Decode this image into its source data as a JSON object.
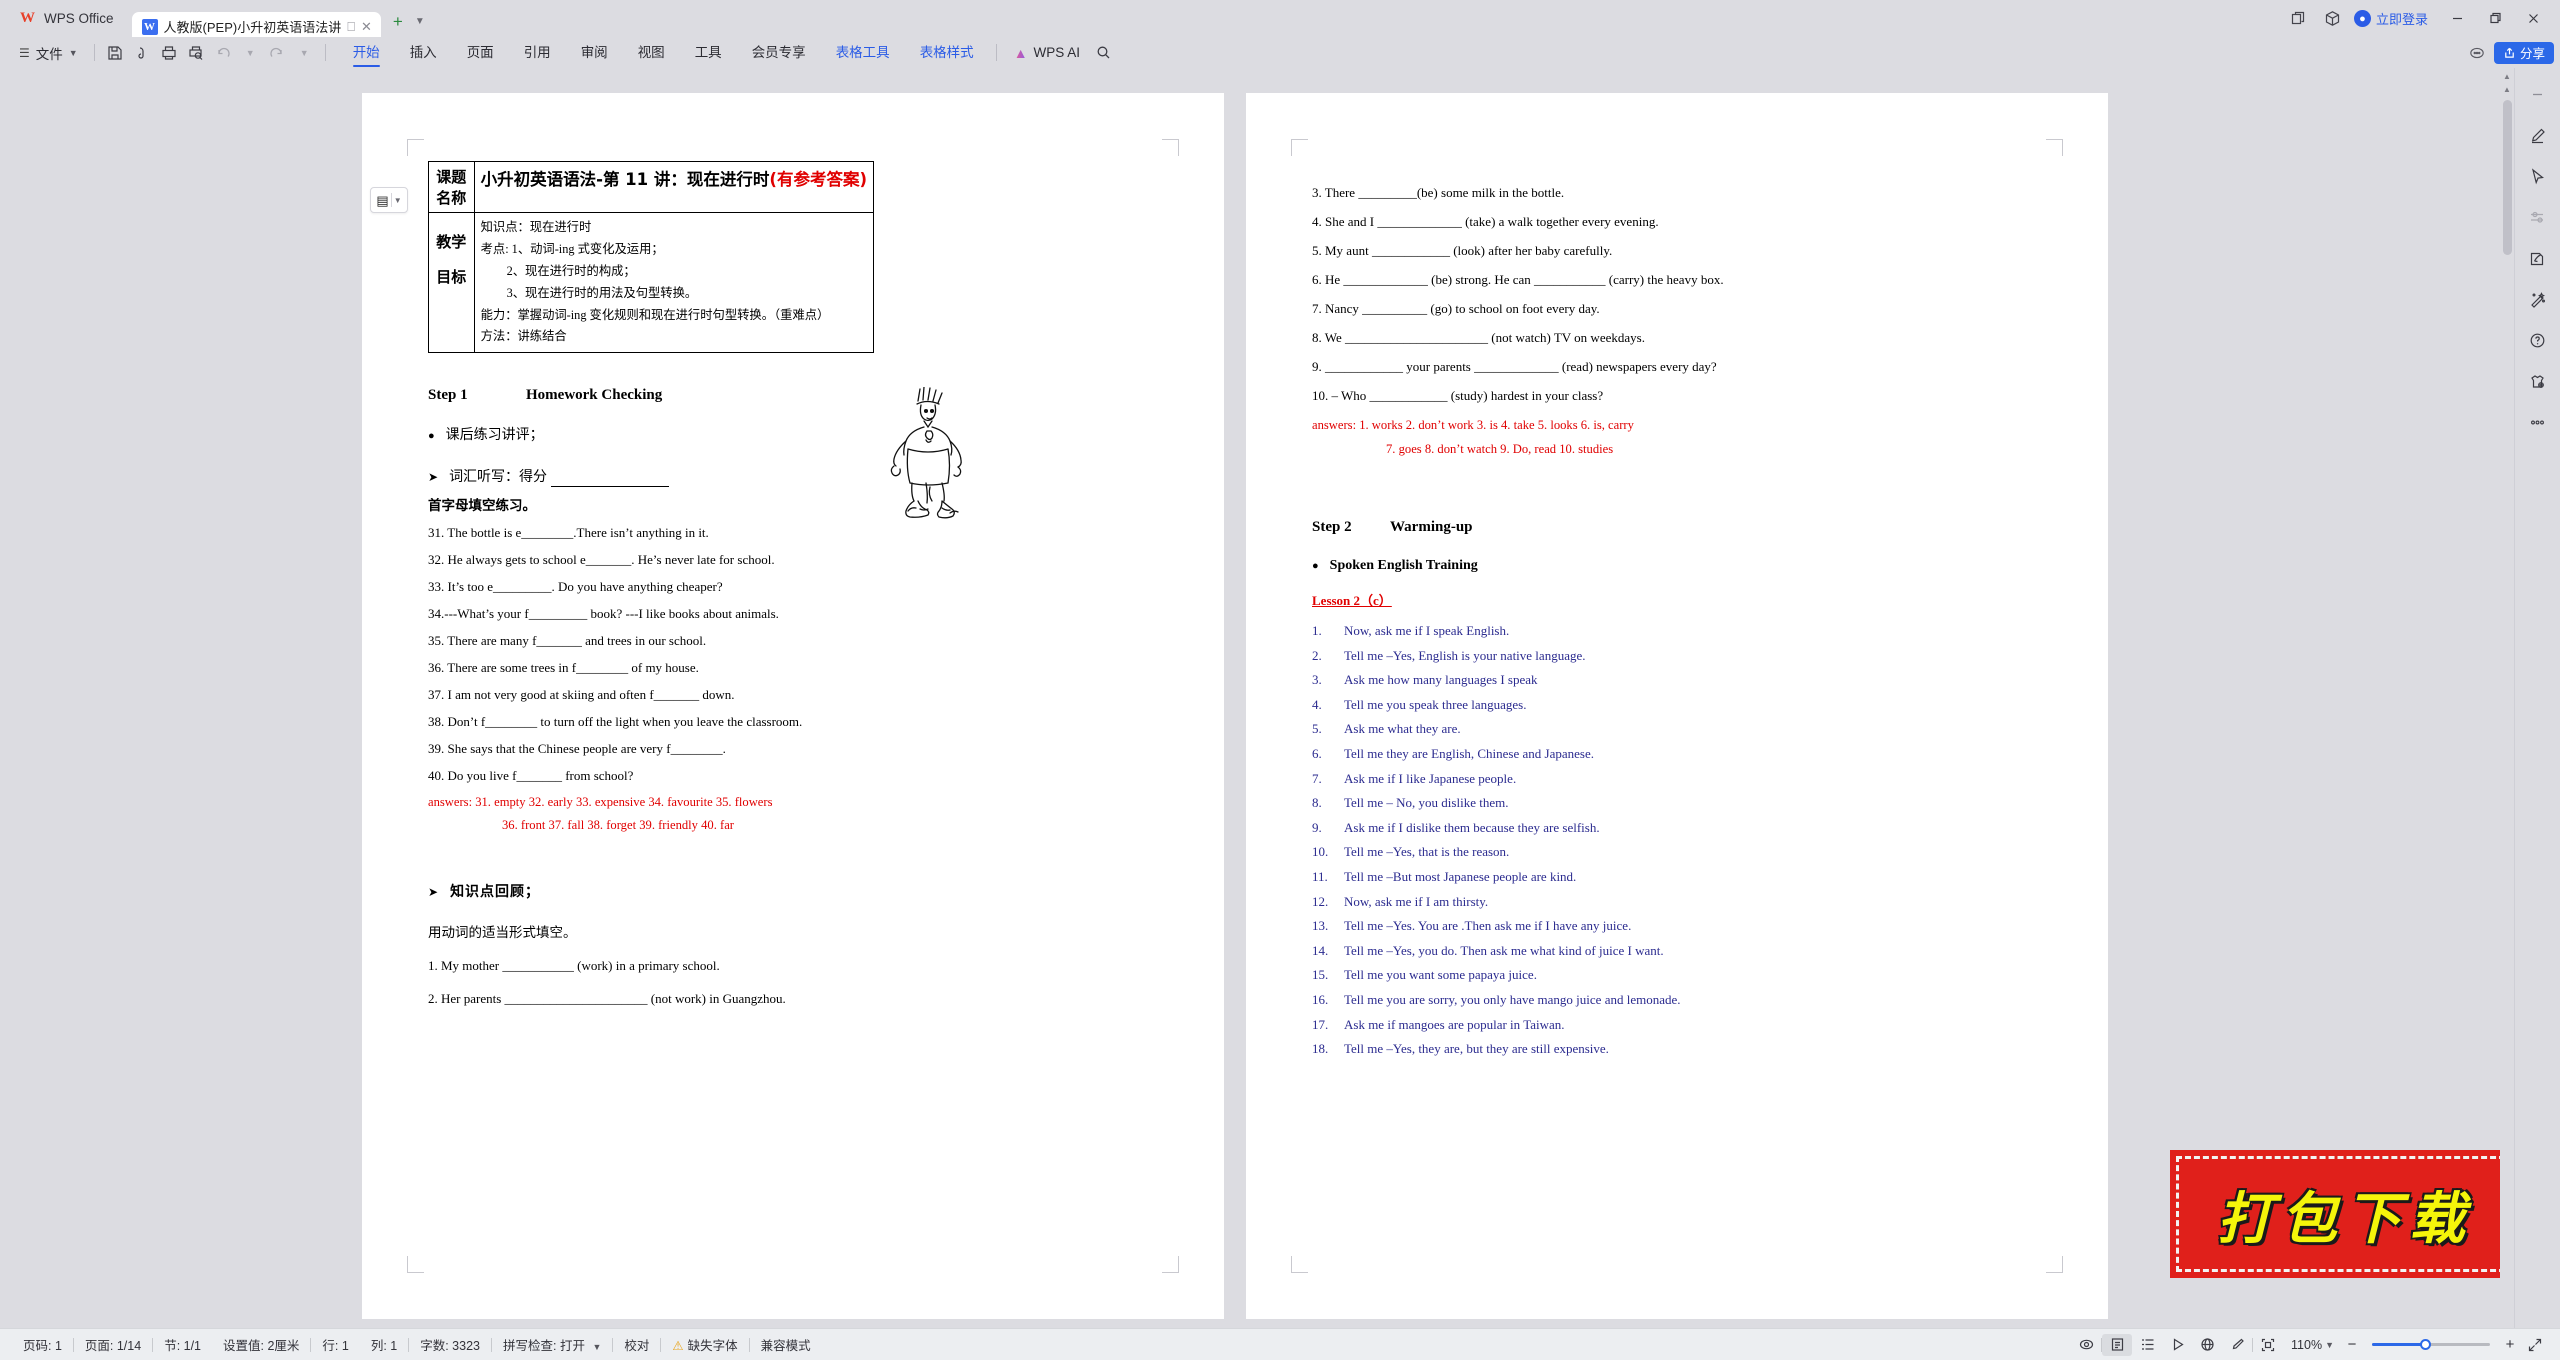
{
  "app": {
    "name": "WPS Office",
    "tab_title": "人教版(PEP)小升初英语语法讲",
    "login_label": "立即登录",
    "share_label": "分享"
  },
  "ribbon": {
    "file_menu": "文件",
    "tabs": [
      {
        "label": "开始",
        "active": true
      },
      {
        "label": "插入",
        "active": false
      },
      {
        "label": "页面",
        "active": false
      },
      {
        "label": "引用",
        "active": false
      },
      {
        "label": "审阅",
        "active": false
      },
      {
        "label": "视图",
        "active": false
      },
      {
        "label": "工具",
        "active": false
      },
      {
        "label": "会员专享",
        "active": false
      },
      {
        "label": "表格工具",
        "active": false,
        "blue": true
      },
      {
        "label": "表格样式",
        "active": false,
        "blue": true
      }
    ],
    "ai_label": "WPS AI"
  },
  "document": {
    "topic_table": {
      "row1_label": "课题名称",
      "row1_title_black": "小升初英语语法-第 11 讲：现在进行时",
      "row1_title_red": "(有参考答案)",
      "row2_label_line1": "教学",
      "row2_label_line2": "目标",
      "goals": [
        "知识点：现在进行时",
        "考点: 1、动词-ing 式变化及运用；",
        "2、现在进行时的构成；",
        "3、现在进行时的用法及句型转换。",
        "能力：掌握动词-ing 变化规则和现在进行时句型转换。（重难点）",
        "方法：讲练结合"
      ]
    },
    "step1": {
      "step_label": "Step 1",
      "step_title": "Homework Checking",
      "bullet_cn": "课后练习讲评；",
      "arrow_cn": "词汇听写：得分",
      "sub_heading": "首字母填空练习。",
      "questions": [
        "31. The bottle is e________.There isn’t anything in it.",
        "32. He always gets to school e_______. He’s never late for school.",
        "33. It’s too e_________. Do you have anything cheaper?",
        "34.---What’s your f_________ book?    ---I like books about animals.",
        "35. There are many f_______ and trees in our school.",
        "36. There are some trees in f________ of my house.",
        "37. I am not very good at skiing and often f_______ down.",
        "38. Don’t f________ to turn off the light when you leave the classroom.",
        "39. She says that the Chinese people are very f________.",
        "40. Do you live f_______ from school?"
      ],
      "answers_line1": "answers: 31. empty    32. early    33. expensive    34. favourite    35. flowers",
      "answers_line2": "36. front    37. fall    38. forget    39. friendly    40. far",
      "review_heading": "知识点回顾；",
      "fill_instruction": "用动词的适当形式填空。",
      "fill_questions_left": [
        "1. My mother ___________ (work) in a primary school.",
        "2. Her parents ______________________ (not work) in Guangzhou."
      ]
    },
    "page2": {
      "fill_questions_right": [
        "3. There _________(be) some milk in the bottle.",
        "4. She and I _____________ (take) a walk together every evening.",
        "5. My aunt ____________ (look) after her baby carefully.",
        "6. He _____________ (be) strong. He can ___________ (carry) the heavy box.",
        "7. Nancy __________ (go) to school on foot every day.",
        "8. We ______________________ (not watch) TV on weekdays.",
        "9. ____________ your parents _____________ (read) newspapers every day?",
        "10. – Who ____________ (study) hardest in your class?"
      ],
      "answers_line1": "answers: 1. works    2. don’t work    3. is    4. take    5. looks    6. is, carry",
      "answers_line2": "7. goes    8. don’t watch    9. Do, read    10. studies",
      "step_label": "Step 2",
      "step_title": "Warming-up",
      "bullet_heading": "Spoken English Training",
      "lesson_label": "Lesson 2（c）",
      "dialogue": [
        "Now, ask me if I speak English.",
        "Tell me –Yes, English is your native language.",
        "Ask me how many languages I speak",
        "Tell me you speak three languages.",
        "Ask me what they are.",
        "Tell me they are English, Chinese and Japanese.",
        "Ask me if I like Japanese people.",
        "Tell me – No, you dislike them.",
        "Ask me if I dislike them because they are selfish.",
        "Tell me –Yes, that is the reason.",
        "Tell me –But most Japanese people are kind.",
        "Now, ask me if I am thirsty.",
        "Tell me –Yes. You are .Then ask me if I have any juice.",
        "Tell me –Yes, you do. Then ask me what kind of juice I want.",
        "Tell me you want some papaya juice.",
        "Tell me you are sorry, you only have mango juice and lemonade.",
        "Ask me if mangoes are popular in Taiwan.",
        "Tell me –Yes, they are, but they are still expensive."
      ]
    }
  },
  "statusbar": {
    "items": [
      "页码: 1",
      "页面: 1/14",
      "节: 1/1",
      "设置值: 2厘米",
      "行: 1",
      "列: 1",
      "字数: 3323",
      "拼写检查: 打开",
      "校对",
      "缺失字体",
      "兼容模式"
    ],
    "zoom": "110%"
  },
  "watermark": {
    "text": "打包下载"
  },
  "colors": {
    "accent": "#2b68e8",
    "answer_red": "#e00000",
    "dialogue_blue": "#2b2b8f",
    "watermark_red": "#e0201b",
    "watermark_yellow": "#f5f50a"
  }
}
